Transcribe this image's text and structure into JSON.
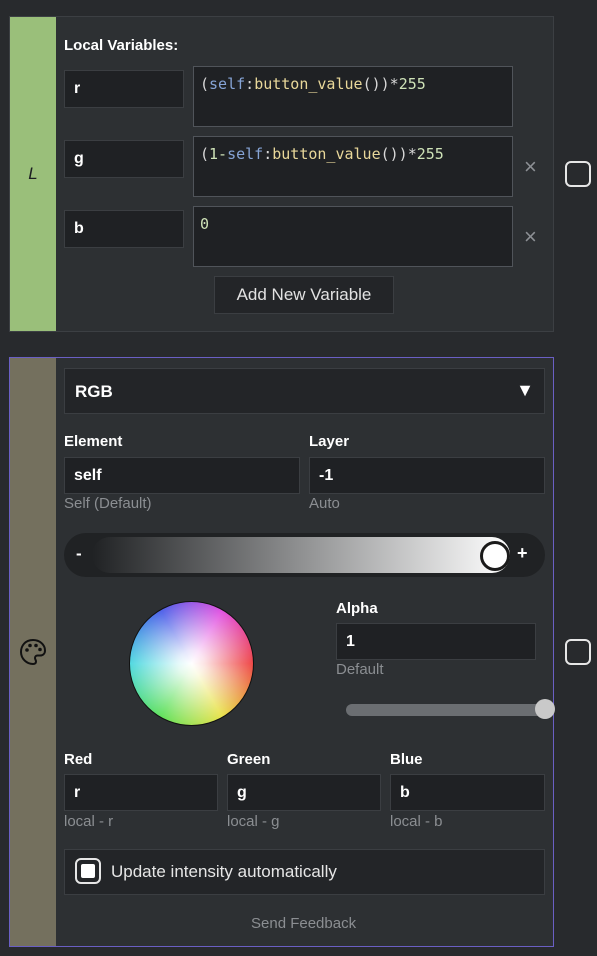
{
  "local": {
    "side_letter": "L",
    "title": "Local Variables:",
    "vars": [
      {
        "name": "r"
      },
      {
        "name": "g"
      },
      {
        "name": "b"
      }
    ],
    "expr_r": {
      "kw": "self",
      "fn": "button_value",
      "a": "(",
      "b": ":",
      "c": "())*",
      "num": "255"
    },
    "expr_g": {
      "a": "(",
      "one": "1-",
      "kw": "self",
      "b": ":",
      "fn": "button_value",
      "c": "())*",
      "num": "255"
    },
    "expr_b": "0",
    "remove_glyph": "×",
    "add_label": "Add New Variable"
  },
  "rgb": {
    "mode": "RGB",
    "mode_arrow": "▼",
    "element_label": "Element",
    "element_value": "self",
    "element_hint": "Self (Default)",
    "layer_label": "Layer",
    "layer_value": "-1",
    "layer_hint": "Auto",
    "intensity": {
      "minus": "-",
      "plus": "+",
      "value": 1.0
    },
    "alpha_label": "Alpha",
    "alpha_value": "1",
    "alpha_hint": "Default",
    "alpha_slider_value": 1.0,
    "red_label": "Red",
    "red_value": "r",
    "red_hint": "local - r",
    "green_label": "Green",
    "green_value": "g",
    "green_hint": "local - g",
    "blue_label": "Blue",
    "blue_value": "b",
    "blue_hint": "local - b",
    "auto_label": "Update intensity automatically",
    "feedback": "Send Feedback",
    "icon": "palette-icon"
  },
  "colors": {
    "local_accent": "#9abf7a",
    "color_accent": "#74705e",
    "selected_border": "#6a5fc4"
  }
}
